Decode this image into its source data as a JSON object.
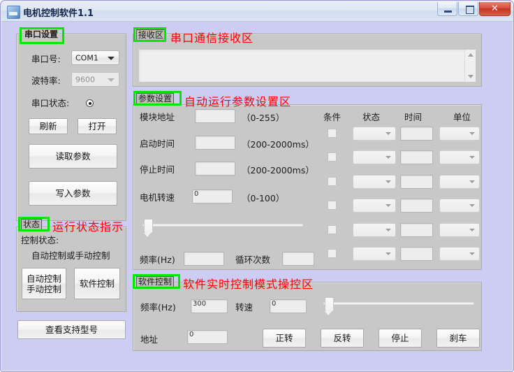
{
  "window": {
    "title": "电机控制软件1.1",
    "minimize_label": "最小化",
    "maximize_label": "最大化",
    "close_label": "✕"
  },
  "serial_panel": {
    "title": "串口设置",
    "port_label": "串口号:",
    "port_value": "COM1",
    "baud_label": "波特率:",
    "baud_value": "9600",
    "status_label": "串口状态:",
    "refresh_button": "刷新",
    "open_button": "打开",
    "read_params_button": "读取参数",
    "write_params_button": "写入参数"
  },
  "status_panel": {
    "title": "状态",
    "annotation": "运行状态指示",
    "control_state_label": "控制状态:",
    "control_state_value": "自动控制或手动控制",
    "auto_manual_button": "自动控制\n手动控制",
    "software_control_button": "软件控制",
    "view_models_button": "查看支持型号"
  },
  "receive_panel": {
    "title": "接收区",
    "annotation": "串口通信接收区",
    "content": ""
  },
  "param_panel": {
    "title": "参数设置",
    "annotation": "自动运行参数设置区",
    "module_address_label": "模块地址",
    "module_address_value": "",
    "module_address_range": "（0-255）",
    "start_time_label": "启动时间",
    "start_time_value": "",
    "start_time_range": "（200-2000ms）",
    "stop_time_label": "停止时间",
    "stop_time_value": "",
    "stop_time_range": "（200-2000ms）",
    "motor_speed_label": "电机转速",
    "motor_speed_value": "0",
    "motor_speed_range": "（0-100）",
    "speed_slider_value": 0,
    "frequency_label": "频率(Hz)",
    "frequency_value": "",
    "loop_count_label": "循环次数",
    "loop_count_value": "",
    "columns": {
      "condition": "条件",
      "state": "状态",
      "time": "时间",
      "unit": "单位"
    },
    "rows": [
      {
        "checked": false,
        "state": "",
        "time": "",
        "unit": ""
      },
      {
        "checked": false,
        "state": "",
        "time": "",
        "unit": ""
      },
      {
        "checked": false,
        "state": "",
        "time": "",
        "unit": ""
      },
      {
        "checked": false,
        "state": "",
        "time": "",
        "unit": ""
      },
      {
        "checked": false,
        "state": "",
        "time": "",
        "unit": ""
      },
      {
        "checked": false,
        "state": "",
        "time": "",
        "unit": ""
      }
    ]
  },
  "software_panel": {
    "title": "软件控制",
    "annotation": "软件实时控制模式操控区",
    "frequency_label": "频率(Hz)",
    "frequency_value": "300",
    "speed_label": "转速",
    "speed_value": "0",
    "speed_slider_value": 0,
    "address_label": "地址",
    "address_value": "0",
    "forward_button": "正转",
    "reverse_button": "反转",
    "stop_button": "停止",
    "brake_button": "刹车"
  },
  "colors": {
    "window_bg": "#cdccf2",
    "panel_bg": "#c8c8c8",
    "annotation_red": "#ff0000",
    "highlight_green": "#00e800",
    "title_blue": "#12264a"
  }
}
